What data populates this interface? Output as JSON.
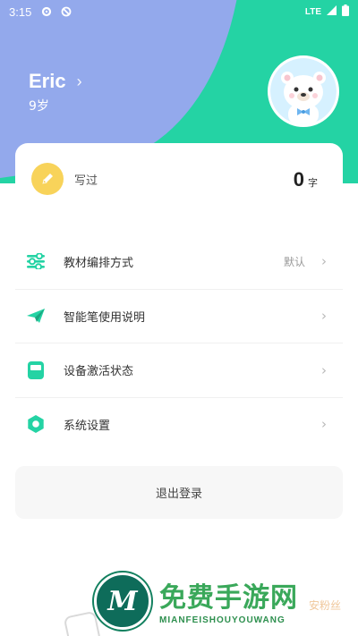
{
  "status_bar": {
    "time": "3:15",
    "network": "LTE",
    "icons": [
      "settings-icon",
      "sync-icon",
      "signal-icon",
      "battery-icon"
    ]
  },
  "profile": {
    "name": "Eric",
    "age": "9岁",
    "chevron": "›"
  },
  "stats": {
    "label": "写过",
    "count": "0",
    "unit": "字",
    "icon": "pencil-icon"
  },
  "menu": [
    {
      "label": "教材编排方式",
      "value": "默认",
      "icon": "sliders-icon"
    },
    {
      "label": "智能笔使用说明",
      "value": "",
      "icon": "paper-plane-icon"
    },
    {
      "label": "设备激活状态",
      "value": "",
      "icon": "device-icon"
    },
    {
      "label": "系统设置",
      "value": "",
      "icon": "gear-icon"
    }
  ],
  "chevron": "›",
  "logout_label": "退出登录",
  "watermark": {
    "title": "免费手游网",
    "subtitle": "MIANFEISHOUYOUWANG",
    "logo_letter": "M",
    "extra": "安粉丝"
  },
  "colors": {
    "accent": "#24d3a4",
    "header_blob": "#93a9ec",
    "pencil_badge": "#f8d35a"
  }
}
